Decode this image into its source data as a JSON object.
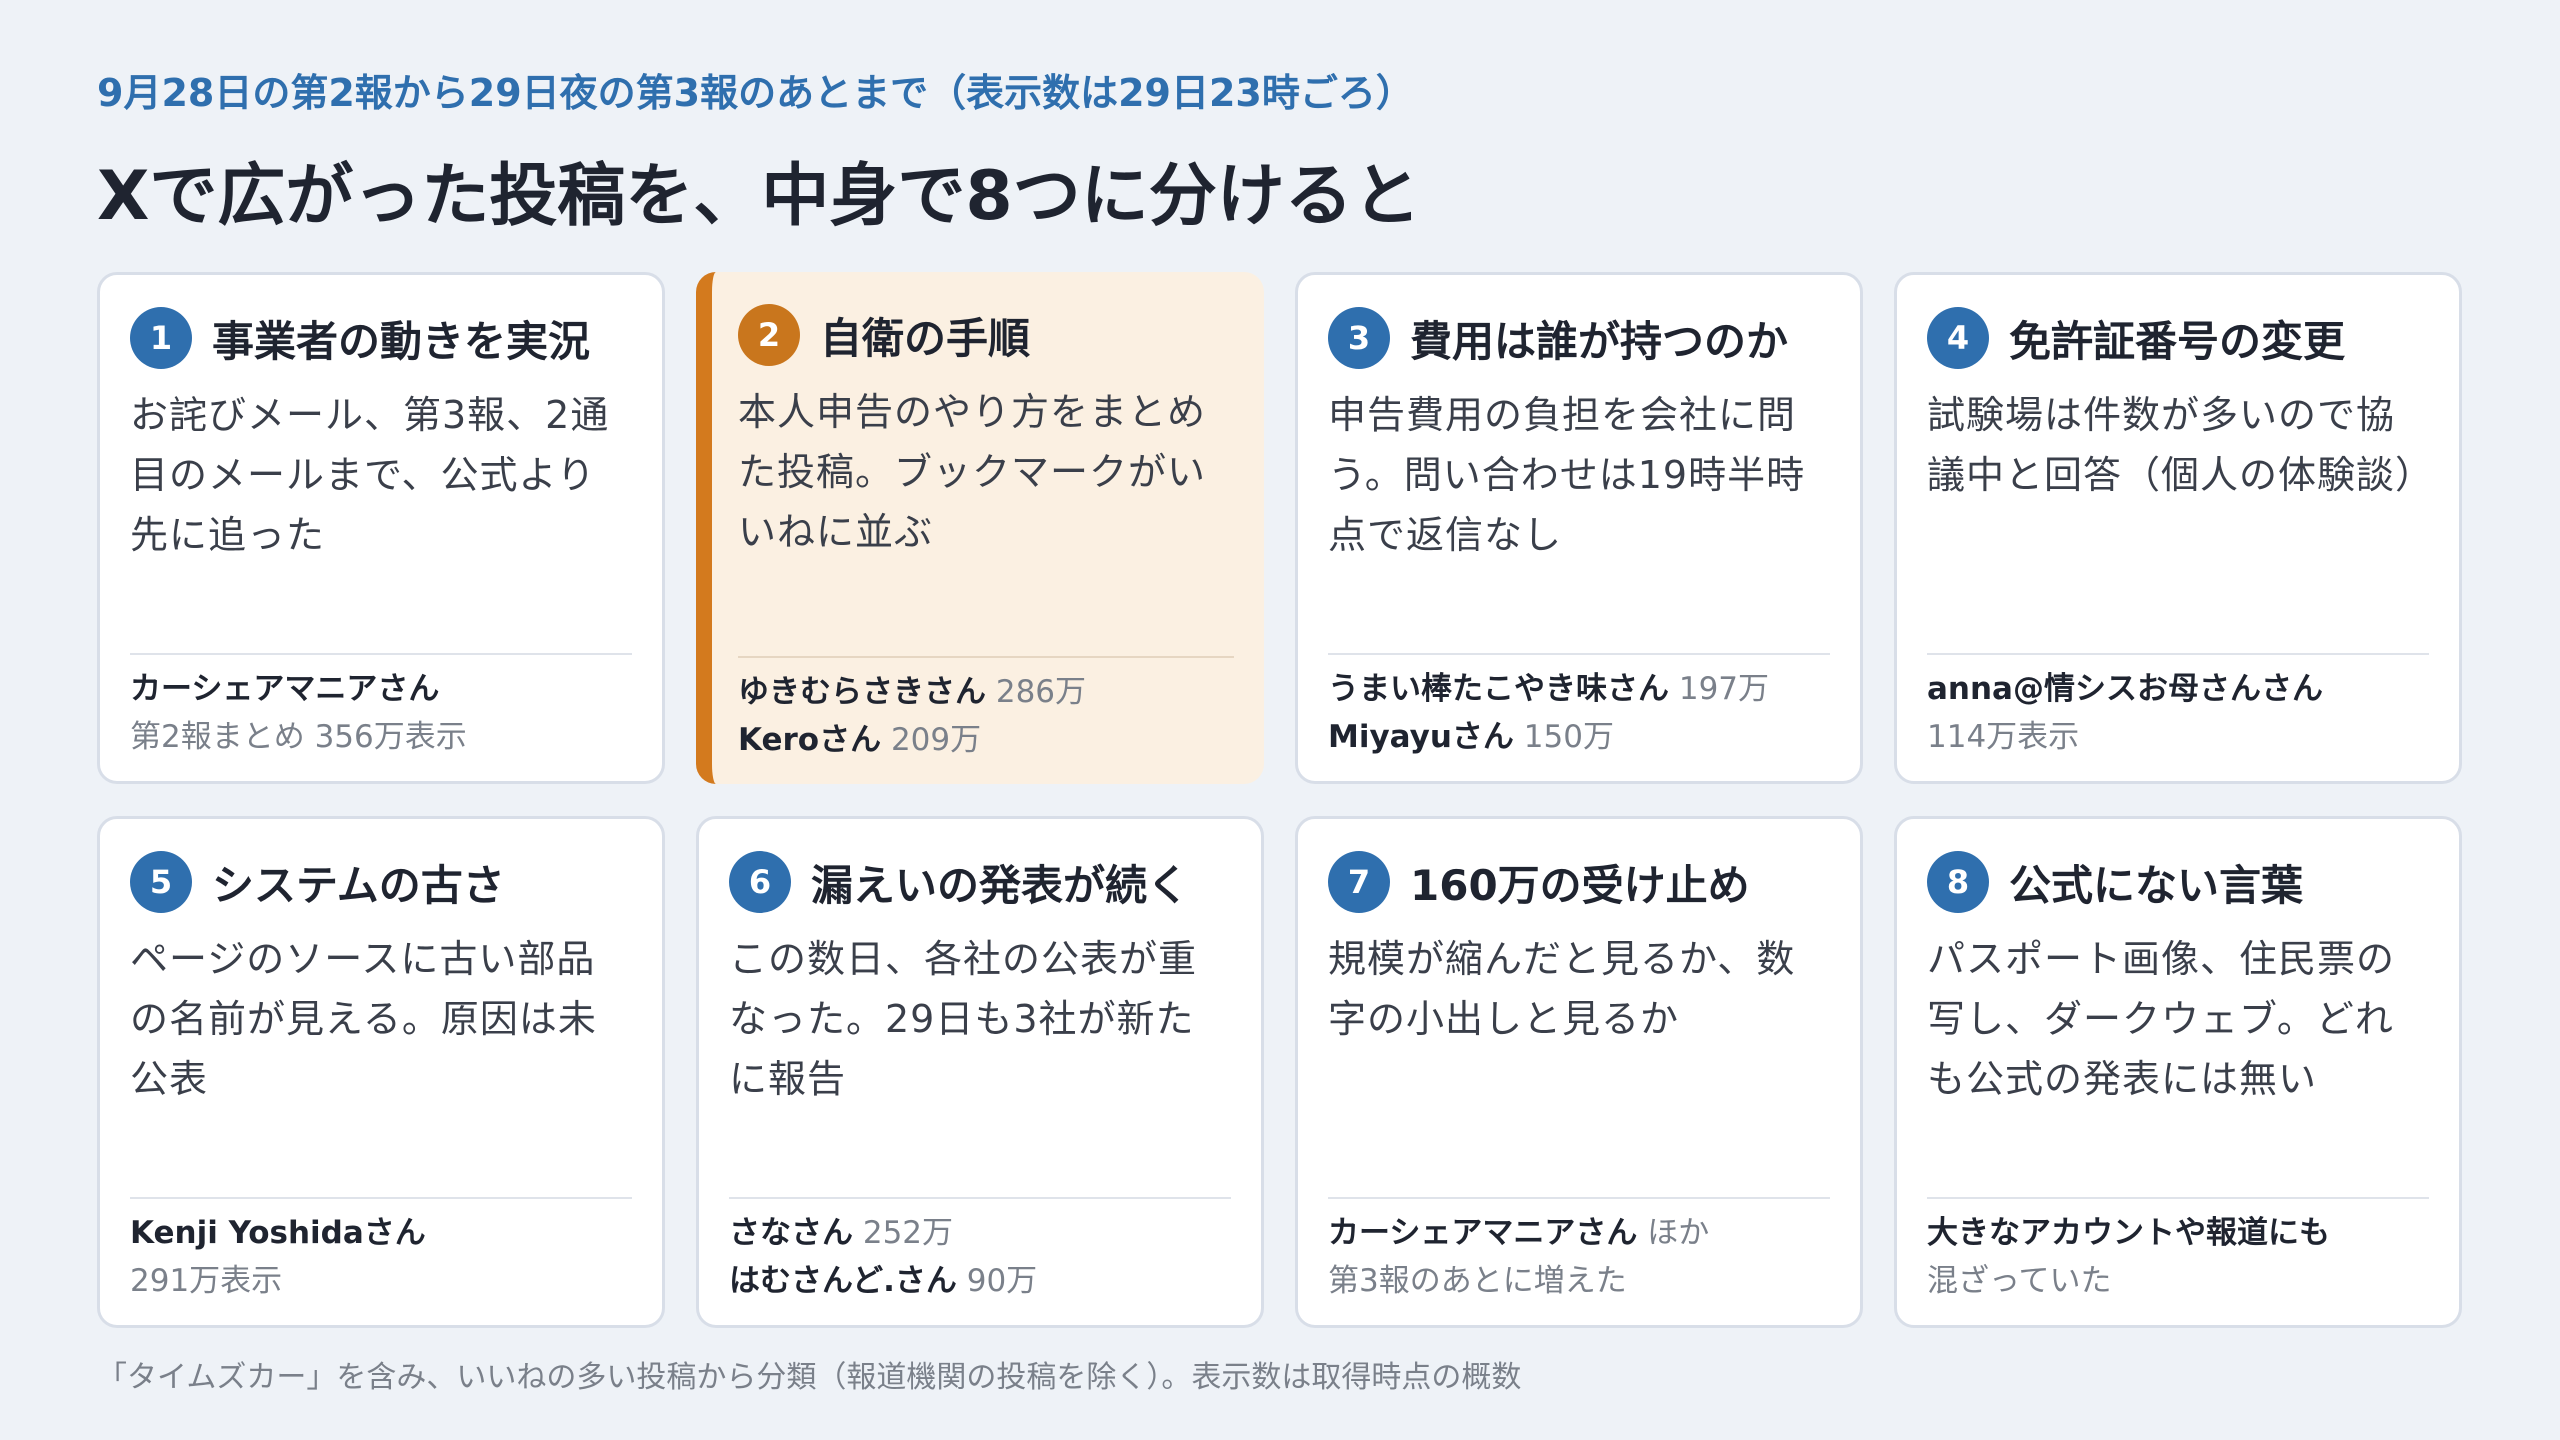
{
  "header": {
    "subtitle": "9月28日の第2報から29日夜の第3報のあとまで（表示数は29日23時ごろ）",
    "title": "Xで広がった投稿を、中身で8つに分けると"
  },
  "cards": [
    {
      "num": "1",
      "title": "事業者の動きを実況",
      "body": "お詫びメール、第3報、2通目のメールまで、公式より先に追った",
      "foot": [
        {
          "strong": "カーシェアマニアさん",
          "muted": ""
        },
        {
          "strong": "",
          "muted": "第2報まとめ 356万表示"
        }
      ]
    },
    {
      "num": "2",
      "title": "自衛の手順",
      "body": "本人申告のやり方をまとめた投稿。ブックマークがいいねに並ぶ",
      "foot": [
        {
          "strong": "ゆきむらさきさん",
          "muted": "286万"
        },
        {
          "strong": "Keroさん",
          "muted": "209万"
        }
      ]
    },
    {
      "num": "3",
      "title": "費用は誰が持つのか",
      "body": "申告費用の負担を会社に問う。問い合わせは19時半時点で返信なし",
      "foot": [
        {
          "strong": "うまい棒たこやき味さん",
          "muted": "197万"
        },
        {
          "strong": "Miyayuさん",
          "muted": "150万"
        }
      ]
    },
    {
      "num": "4",
      "title": "免許証番号の変更",
      "body": "試験場は件数が多いので協議中と回答（個人の体験談）",
      "foot": [
        {
          "strong": "anna@情シスお母さんさん",
          "muted": ""
        },
        {
          "strong": "",
          "muted": "114万表示"
        }
      ]
    },
    {
      "num": "5",
      "title": "システムの古さ",
      "body": "ページのソースに古い部品の名前が見える。原因は未公表",
      "foot": [
        {
          "strong": "Kenji Yoshidaさん",
          "muted": ""
        },
        {
          "strong": "",
          "muted": "291万表示"
        }
      ]
    },
    {
      "num": "6",
      "title": "漏えいの発表が続く",
      "body": "この数日、各社の公表が重なった。29日も3社が新たに報告",
      "foot": [
        {
          "strong": "さなさん",
          "muted": "252万"
        },
        {
          "strong": "はむさんど.さん",
          "muted": "90万"
        }
      ]
    },
    {
      "num": "7",
      "title": "160万の受け止め",
      "body": "規模が縮んだと見るか、数字の小出しと見るか",
      "foot": [
        {
          "strong": "カーシェアマニアさん",
          "muted": "ほか"
        },
        {
          "strong": "",
          "muted": "第3報のあとに増えた"
        }
      ]
    },
    {
      "num": "8",
      "title": "公式にない言葉",
      "body": "パスポート画像、住民票の写し、ダークウェブ。どれも公式の発表には無い",
      "foot": [
        {
          "strong": "大きなアカウントや報道にも",
          "muted": ""
        },
        {
          "strong": "",
          "muted": "混ざっていた"
        }
      ]
    }
  ],
  "footer": {
    "note": "「タイムズカー」を含み、いいねの多い投稿から分類（報道機関の投稿を除く）。表示数は取得時点の概数"
  },
  "colors": {
    "accent_blue": "#2f6fae",
    "accent_orange": "#c9761d",
    "highlight_bg": "#fbf0e2"
  }
}
